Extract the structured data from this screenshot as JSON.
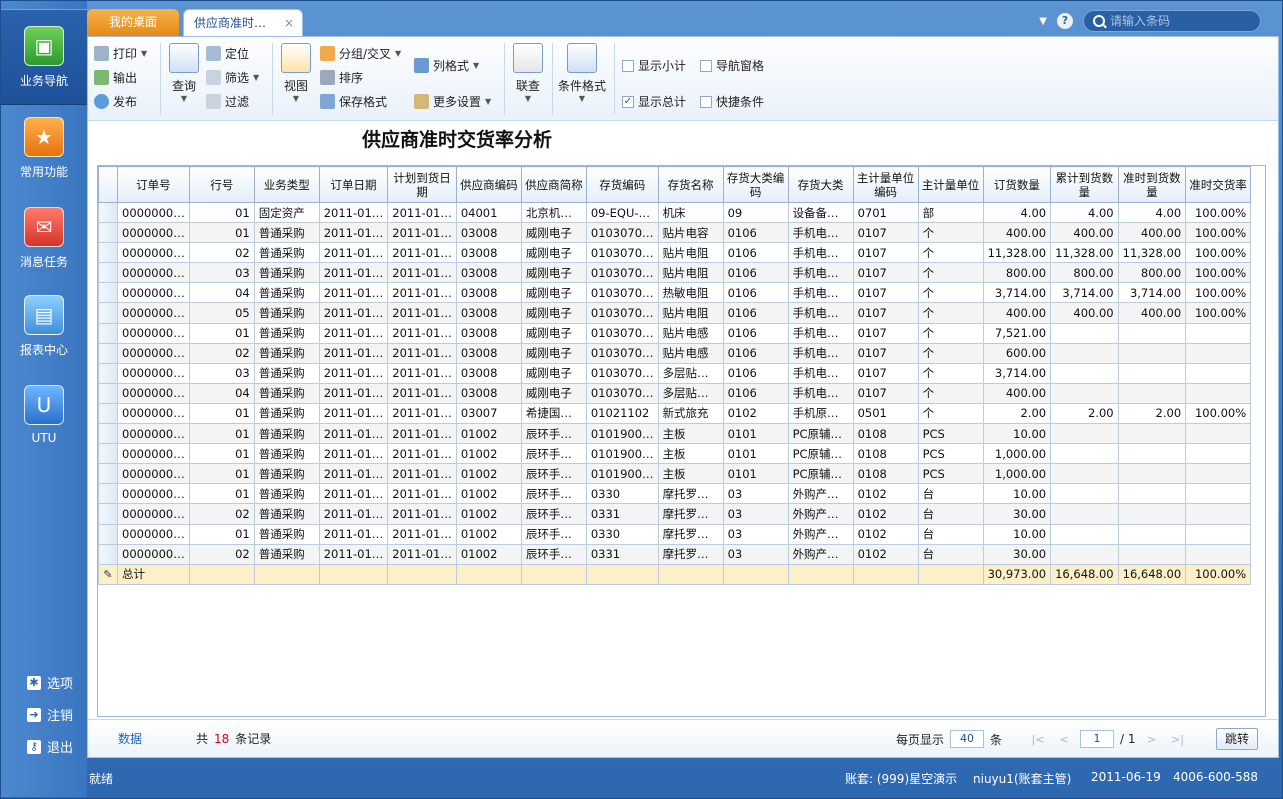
{
  "leftnav": {
    "items": [
      {
        "label": "业务导航"
      },
      {
        "label": "常用功能"
      },
      {
        "label": "消息任务"
      },
      {
        "label": "报表中心"
      },
      {
        "label": "UTU"
      }
    ],
    "bottom": [
      {
        "label": "选项"
      },
      {
        "label": "注销"
      },
      {
        "label": "退出"
      }
    ]
  },
  "tabs": {
    "home": "我的桌面",
    "active": "供应商准时…",
    "close": "×"
  },
  "search": {
    "placeholder": "请输入条码"
  },
  "ribbon": {
    "print": "打印",
    "export": "输出",
    "publish": "发布",
    "query": "查询",
    "locate": "定位",
    "filter": "筛选",
    "filter2": "过滤",
    "view": "视图",
    "group": "分组/交叉",
    "sort": "排序",
    "save_format": "保存格式",
    "col_format": "列格式",
    "more_settings": "更多设置",
    "join_query": "联查",
    "cond_format": "条件格式",
    "show_subtotal": "显示小计",
    "show_subtotal_checked": false,
    "nav_pane": "导航窗格",
    "nav_pane_checked": false,
    "show_total": "显示总计",
    "show_total_checked": true,
    "quick_cond": "快捷条件",
    "quick_cond_checked": false
  },
  "report_title": "供应商准时交货率分析",
  "columns": [
    "订单号",
    "行号",
    "业务类型",
    "订单日期",
    "计划到货日期",
    "供应商编码",
    "供应商简称",
    "存货编码",
    "存货名称",
    "存货大类编码",
    "存货大类",
    "主计量单位编码",
    "主计量单位",
    "订货数量",
    "累计到货数量",
    "准时到货数量",
    "准时交货率"
  ],
  "rows": [
    [
      "0000000…",
      "01",
      "固定资产",
      "2011-01…",
      "2011-01…",
      "04001",
      "北京机…",
      "09-EQU-…",
      "机床",
      "09",
      "设备备…",
      "0701",
      "部",
      "4.00",
      "4.00",
      "4.00",
      "100.00%"
    ],
    [
      "0000000…",
      "01",
      "普通采购",
      "2011-01…",
      "2011-01…",
      "03008",
      "威刚电子",
      "0103070…",
      "贴片电容",
      "0106",
      "手机电…",
      "0107",
      "个",
      "400.00",
      "400.00",
      "400.00",
      "100.00%"
    ],
    [
      "0000000…",
      "02",
      "普通采购",
      "2011-01…",
      "2011-01…",
      "03008",
      "威刚电子",
      "0103070…",
      "贴片电阻",
      "0106",
      "手机电…",
      "0107",
      "个",
      "11,328.00",
      "11,328.00",
      "11,328.00",
      "100.00%"
    ],
    [
      "0000000…",
      "03",
      "普通采购",
      "2011-01…",
      "2011-01…",
      "03008",
      "威刚电子",
      "0103070…",
      "贴片电阻",
      "0106",
      "手机电…",
      "0107",
      "个",
      "800.00",
      "800.00",
      "800.00",
      "100.00%"
    ],
    [
      "0000000…",
      "04",
      "普通采购",
      "2011-01…",
      "2011-01…",
      "03008",
      "威刚电子",
      "0103070…",
      "热敏电阻",
      "0106",
      "手机电…",
      "0107",
      "个",
      "3,714.00",
      "3,714.00",
      "3,714.00",
      "100.00%"
    ],
    [
      "0000000…",
      "05",
      "普通采购",
      "2011-01…",
      "2011-01…",
      "03008",
      "威刚电子",
      "0103070…",
      "贴片电阻",
      "0106",
      "手机电…",
      "0107",
      "个",
      "400.00",
      "400.00",
      "400.00",
      "100.00%"
    ],
    [
      "0000000…",
      "01",
      "普通采购",
      "2011-01…",
      "2011-01…",
      "03008",
      "威刚电子",
      "0103070…",
      "贴片电感",
      "0106",
      "手机电…",
      "0107",
      "个",
      "7,521.00",
      "",
      "",
      ""
    ],
    [
      "0000000…",
      "02",
      "普通采购",
      "2011-01…",
      "2011-01…",
      "03008",
      "威刚电子",
      "0103070…",
      "贴片电感",
      "0106",
      "手机电…",
      "0107",
      "个",
      "600.00",
      "",
      "",
      ""
    ],
    [
      "0000000…",
      "03",
      "普通采购",
      "2011-01…",
      "2011-01…",
      "03008",
      "威刚电子",
      "0103070…",
      "多层贴…",
      "0106",
      "手机电…",
      "0107",
      "个",
      "3,714.00",
      "",
      "",
      ""
    ],
    [
      "0000000…",
      "04",
      "普通采购",
      "2011-01…",
      "2011-01…",
      "03008",
      "威刚电子",
      "0103070…",
      "多层贴…",
      "0106",
      "手机电…",
      "0107",
      "个",
      "400.00",
      "",
      "",
      ""
    ],
    [
      "0000000…",
      "01",
      "普通采购",
      "2011-01…",
      "2011-01…",
      "03007",
      "希捷国…",
      "01021102",
      "新式旅充",
      "0102",
      "手机原…",
      "0501",
      "个",
      "2.00",
      "2.00",
      "2.00",
      "100.00%"
    ],
    [
      "0000000…",
      "01",
      "普通采购",
      "2011-01…",
      "2011-01…",
      "01002",
      "辰环手…",
      "0101900…",
      "主板",
      "0101",
      "PC原辅…",
      "0108",
      "PCS",
      "10.00",
      "",
      "",
      ""
    ],
    [
      "0000000…",
      "01",
      "普通采购",
      "2011-01…",
      "2011-01…",
      "01002",
      "辰环手…",
      "0101900…",
      "主板",
      "0101",
      "PC原辅…",
      "0108",
      "PCS",
      "1,000.00",
      "",
      "",
      ""
    ],
    [
      "0000000…",
      "01",
      "普通采购",
      "2011-01…",
      "2011-01…",
      "01002",
      "辰环手…",
      "0101900…",
      "主板",
      "0101",
      "PC原辅…",
      "0108",
      "PCS",
      "1,000.00",
      "",
      "",
      ""
    ],
    [
      "0000000…",
      "01",
      "普通采购",
      "2011-01…",
      "2011-01…",
      "01002",
      "辰环手…",
      "0330",
      "摩托罗…",
      "03",
      "外购产…",
      "0102",
      "台",
      "10.00",
      "",
      "",
      ""
    ],
    [
      "0000000…",
      "02",
      "普通采购",
      "2011-01…",
      "2011-01…",
      "01002",
      "辰环手…",
      "0331",
      "摩托罗…",
      "03",
      "外购产…",
      "0102",
      "台",
      "30.00",
      "",
      "",
      ""
    ],
    [
      "0000000…",
      "01",
      "普通采购",
      "2011-01…",
      "2011-01…",
      "01002",
      "辰环手…",
      "0330",
      "摩托罗…",
      "03",
      "外购产…",
      "0102",
      "台",
      "10.00",
      "",
      "",
      ""
    ],
    [
      "0000000…",
      "02",
      "普通采购",
      "2011-01…",
      "2011-01…",
      "01002",
      "辰环手…",
      "0331",
      "摩托罗…",
      "03",
      "外购产…",
      "0102",
      "台",
      "30.00",
      "",
      "",
      ""
    ]
  ],
  "total_row": {
    "label": "总计",
    "qty": "30,973.00",
    "arrived": "16,648.00",
    "ontime": "16,648.00",
    "rate": "100.00%"
  },
  "pager": {
    "data_label": "数据",
    "count_prefix": "共",
    "count": "18",
    "count_suffix": "条记录",
    "per_page_label": "每页显示",
    "per_page": "40",
    "per_page_unit": "条",
    "page": "1",
    "total_pages": "/ 1",
    "jump": "跳转"
  },
  "status": {
    "ready": "就绪",
    "account": "账套: (999)星空演示",
    "user": "niuyu1(账套主管)",
    "date": "2011-06-19",
    "phone": "4006-600-588"
  }
}
